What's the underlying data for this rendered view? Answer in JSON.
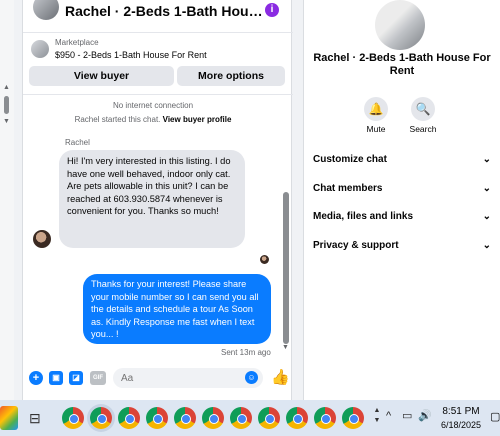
{
  "header": {
    "title": "Rachel · 2-Beds 1-Bath House For R..."
  },
  "listing": {
    "source": "Marketplace",
    "title": "$950 - 2-Beds 1-Bath House For Rent"
  },
  "buttons": {
    "view_buyer": "View buyer",
    "more_options": "More options"
  },
  "system": {
    "connection": "No internet connection",
    "started_prefix": "Rachel started this chat.",
    "view_profile": "View buyer profile"
  },
  "messages": {
    "sender": "Rachel",
    "incoming": "Hi! I'm very interested in this listing. I do have one well behaved, indoor only cat. Are pets allowable in this unit? I can be reached at 603.930.5874 whenever is convenient for you. Thanks so much!",
    "outgoing": "Thanks for your interest! Please share your mobile number so I can send you all the details and schedule a tour As Soon as. Kindly Response me fast when I text you... !",
    "sent_time": "Sent 13m ago"
  },
  "composer": {
    "placeholder": "Aa"
  },
  "info": {
    "name": "Rachel · 2-Beds 1-Bath House For Rent",
    "actions": {
      "mute": "Mute",
      "search": "Search"
    },
    "sections": [
      "Customize chat",
      "Chat members",
      "Media, files and links",
      "Privacy & support"
    ]
  },
  "taskbar": {
    "time": "8:51 PM",
    "date": "6/18/2025"
  },
  "colors": {
    "accent": "#0a7cff",
    "bubble_in": "#e4e6eb",
    "info_badge": "#8a2be2"
  }
}
